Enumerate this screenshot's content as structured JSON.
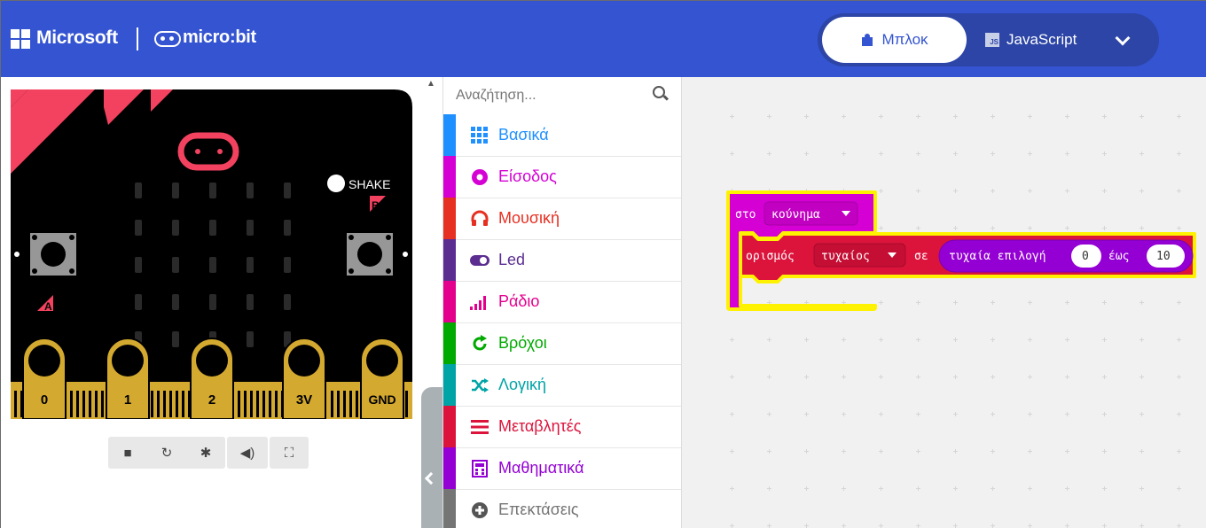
{
  "header": {
    "brand": "Microsoft",
    "product": "micro:bit",
    "blocks_label": "Μπλοκ",
    "javascript_label": "JavaScript",
    "js_badge": "JS",
    "colors": {
      "bg": "#3454d1",
      "toggle_bg": "#2c45a6"
    }
  },
  "simulator": {
    "shake_label": "SHAKE",
    "button_a": "A",
    "button_b": "B",
    "pins": [
      "0",
      "1",
      "2",
      "3V",
      "GND"
    ],
    "toolbar": [
      "stop-icon",
      "restart-icon",
      "debug-icon",
      "sound-icon",
      "fullscreen-icon"
    ]
  },
  "toolbox": {
    "search_placeholder": "Αναζήτηση...",
    "categories": [
      {
        "label": "Βασικά",
        "color": "#1e90ff",
        "icon": "grid-icon"
      },
      {
        "label": "Είσοδος",
        "color": "#d400d4",
        "icon": "input-icon"
      },
      {
        "label": "Μουσική",
        "color": "#e63022",
        "icon": "headphones-icon"
      },
      {
        "label": "Led",
        "color": "#5c2d91",
        "icon": "toggle-icon"
      },
      {
        "label": "Ράδιο",
        "color": "#e3008c",
        "icon": "signal-icon"
      },
      {
        "label": "Βρόχοι",
        "color": "#00aa00",
        "icon": "loop-icon"
      },
      {
        "label": "Λογική",
        "color": "#00a4a6",
        "icon": "shuffle-icon"
      },
      {
        "label": "Μεταβλητές",
        "color": "#dc143c",
        "icon": "list-icon"
      },
      {
        "label": "Μαθηματικά",
        "color": "#9400d3",
        "icon": "calculator-icon"
      },
      {
        "label": "Επεκτάσεις",
        "color": "#757575",
        "icon": "plus-icon"
      }
    ]
  },
  "workspace": {
    "event_block": {
      "prefix": "στο",
      "event": "κούνημα"
    },
    "set_block": {
      "label": "ορισμός",
      "variable": "τυχαίος",
      "to": "σε"
    },
    "random_block": {
      "label": "τυχαία επιλογή",
      "from": "0",
      "to_label": "έως",
      "to_value": "10"
    },
    "colors": {
      "event": "#d400d4",
      "variable": "#dc143c",
      "math": "#9400d3",
      "highlight": "#fff200"
    }
  }
}
